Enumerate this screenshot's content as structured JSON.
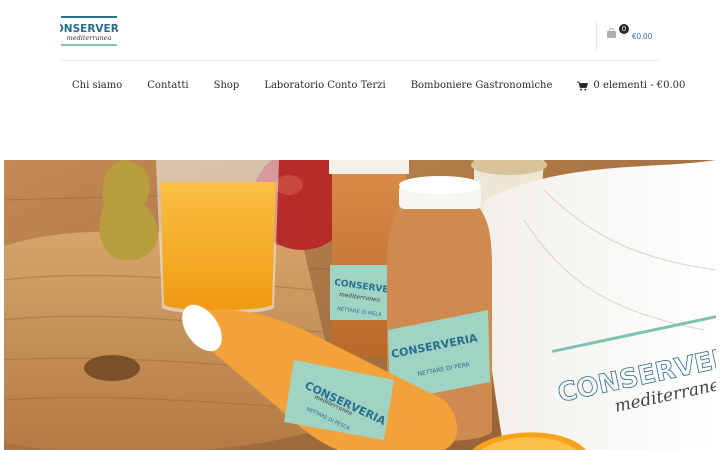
{
  "brand": {
    "logo_text": "CONSERVERIA",
    "logo_subtext": "mediterranea",
    "color_primary": "#2c6e8f",
    "color_accent": "#7fc1b2"
  },
  "mini_cart": {
    "count": "0",
    "total": "€0.00",
    "icon": "shopping-bag-icon"
  },
  "nav": {
    "items": [
      {
        "label": "Chi siamo"
      },
      {
        "label": "Contatti"
      },
      {
        "label": "Shop"
      },
      {
        "label": "Laboratorio Conto Terzi"
      },
      {
        "label": "Bomboniere Gastronomiche"
      }
    ],
    "cart_label": "0 elementi - €0.00",
    "cart_icon": "shopping-cart-icon"
  },
  "hero": {
    "bottle_small_brand": "CONSERVERIA",
    "bottle_small_sub": "mediterranea",
    "bottle_small_label": "NETTARE DI MELA",
    "bottle_large_brand": "CONSERVERIA",
    "bottle_large_label": "NETTARE DI PERA",
    "bottle_lying_brand": "CONSERVERIA",
    "bottle_lying_sub": "mediterranea",
    "bottle_lying_label": "NETTARE DI PESCA",
    "napkin_brand": "CONSERVERIA",
    "napkin_sub": "mediterranea",
    "colors": {
      "wood": "#9a6a3c",
      "juice_orange": "#f2a31a",
      "label_teal": "#9fd3c3"
    }
  }
}
